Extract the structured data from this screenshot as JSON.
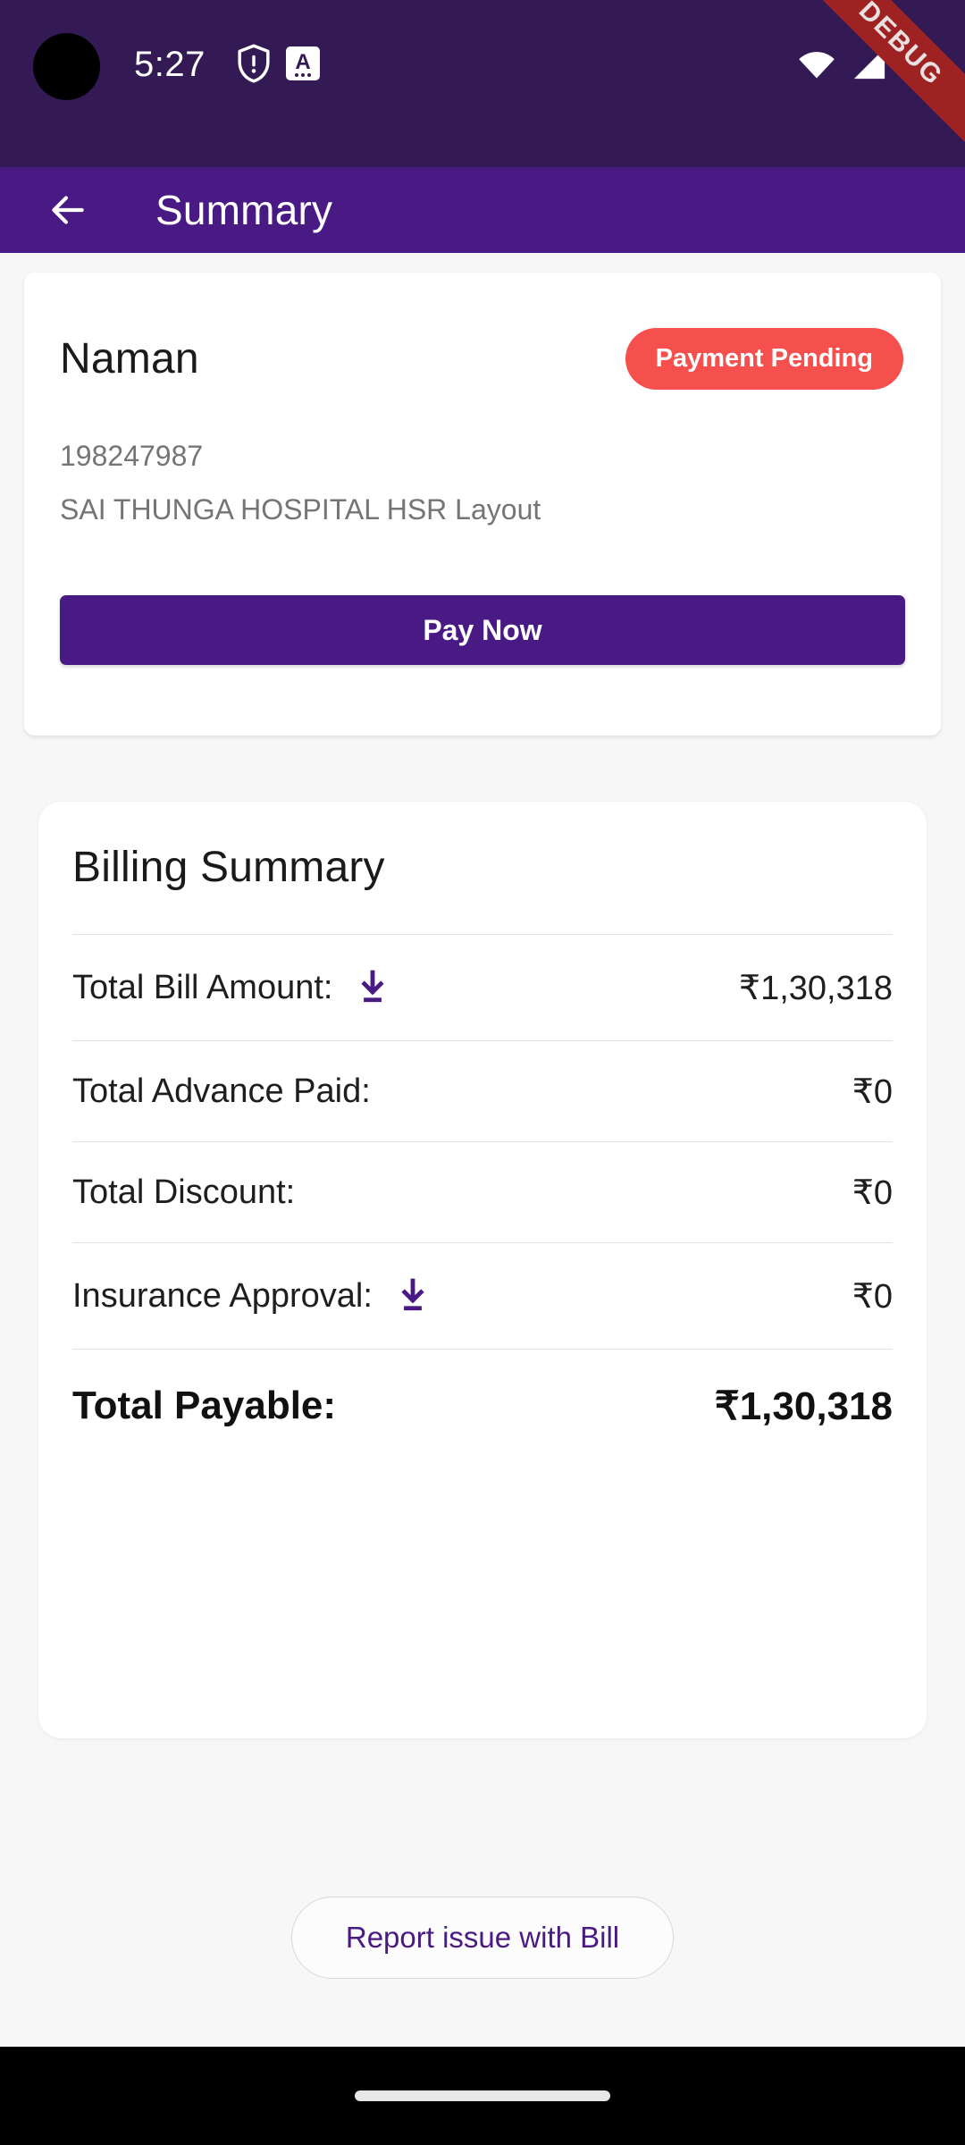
{
  "status_bar": {
    "time": "5:27",
    "shield_icon": "shield-warning-icon",
    "badge_icon": "a-badge-icon",
    "badge_letter": "A",
    "wifi_icon": "wifi-icon",
    "signal_icon": "cellular-signal-icon",
    "debug_label": "DEBUG",
    "background_color": "#331A54"
  },
  "app_bar": {
    "back_icon": "back-arrow-icon",
    "title": "Summary",
    "background_color": "#4A1A84"
  },
  "patient_card": {
    "name": "Naman",
    "status_badge": "Payment Pending",
    "status_badge_color": "#F5504E",
    "patient_id": "198247987",
    "hospital": "SAI THUNGA HOSPITAL HSR Layout",
    "pay_button_label": "Pay Now",
    "pay_button_color": "#4A1A84"
  },
  "billing_summary": {
    "title": "Billing Summary",
    "rows": [
      {
        "label": "Total Bill Amount:",
        "value": "₹1,30,318",
        "icon": "download-icon",
        "has_icon": true,
        "emphasis": false
      },
      {
        "label": "Total Advance Paid:",
        "value": "₹0",
        "icon": "",
        "has_icon": false,
        "emphasis": false
      },
      {
        "label": "Total Discount:",
        "value": "₹0",
        "icon": "",
        "has_icon": false,
        "emphasis": false
      },
      {
        "label": "Insurance Approval:",
        "value": "₹0",
        "icon": "download-icon",
        "has_icon": true,
        "emphasis": false
      },
      {
        "label": "Total Payable:",
        "value": "₹1,30,318",
        "icon": "",
        "has_icon": false,
        "emphasis": true
      }
    ]
  },
  "report_button": {
    "label": "Report issue with Bill",
    "text_color": "#4A1A84"
  },
  "nav_bar": {
    "gesture_handle": "gesture-pill"
  }
}
